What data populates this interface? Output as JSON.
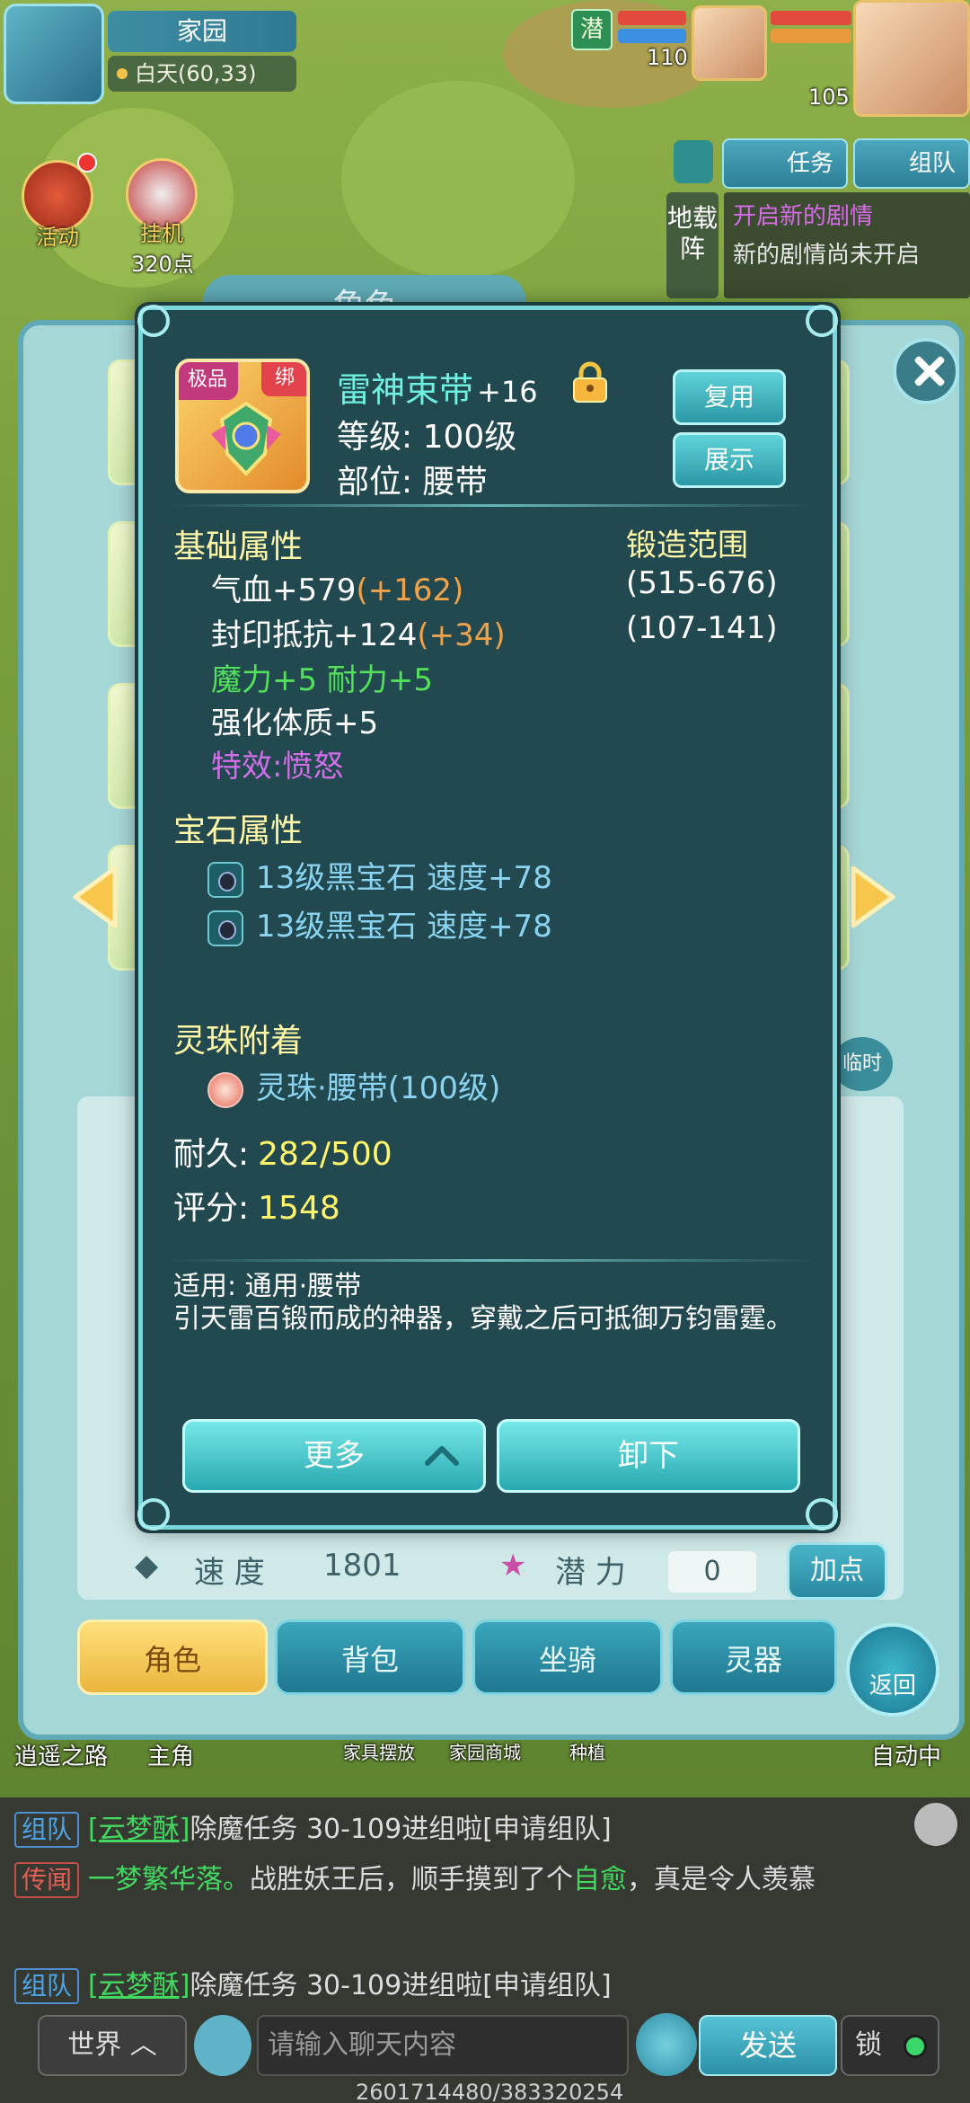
{
  "hud": {
    "home_title": "家园",
    "home_subtitle": "白天(60,33)",
    "activity_label": "活动",
    "idle_label": "挂机",
    "idle_points": "320点",
    "team_level_a": "110",
    "team_level_b": "105",
    "badge_hidden": "潜",
    "task_tab": "任务",
    "team_tab": "组队",
    "vertical_tab": "地载阵",
    "quest_title": "开启新的剧情",
    "quest_desc": "新的剧情尚未开启"
  },
  "character_panel": {
    "title": "角色",
    "speed_label": "速  度",
    "speed_value": "1801",
    "potential_label": "潜  力",
    "potential_value": "0",
    "add_point_button": "加点",
    "temp_label": "临时",
    "tabs": [
      "角色",
      "背包",
      "坐骑",
      "灵器"
    ],
    "return_button": "返回",
    "bottom_left_a": "逍遥之路",
    "bottom_left_b": "主角",
    "bottom_mid_a": "家具摆放",
    "bottom_mid_b": "家园商城",
    "bottom_mid_c": "种植",
    "bottom_right": "自动中"
  },
  "item": {
    "badge_top": "极品",
    "badge_bind": "绑",
    "name": "雷神束带",
    "enhance": "+16",
    "level": "等级: 100级",
    "part": "部位: 腰带",
    "reuse_button": "复用",
    "show_button": "展示",
    "basic_title": "基础属性",
    "forge_title": "锻造范围",
    "attrs": [
      {
        "base": "气血+579",
        "bonus": "(+162)",
        "range": "(515-676)"
      },
      {
        "base": "封印抵抗+124",
        "bonus": "(+34)",
        "range": "(107-141)"
      }
    ],
    "green_attrs": "魔力+5 耐力+5",
    "enhance_attr": "强化体质+5",
    "special_effect": "特效:愤怒",
    "gem_title": "宝石属性",
    "gems": [
      "13级黑宝石 速度+78",
      "13级黑宝石 速度+78"
    ],
    "orb_title": "灵珠附着",
    "orb": "灵珠·腰带(100级)",
    "durability_label": "耐久:",
    "durability_value": "282/500",
    "score_label": "评分:",
    "score_value": "1548",
    "applicable": "适用: 通用·腰带",
    "description": "引天雷百锻而成的神器，穿戴之后可抵御万钧雷霆。",
    "more_button": "更多",
    "unequip_button": "卸下"
  },
  "chat": {
    "lines": [
      {
        "channel": "组队",
        "name": "[云梦酥]",
        "text": "除魔任务 30-109进组啦",
        "link": "[申请组队]"
      },
      {
        "channel": "传闻",
        "pre": "一梦繁华落。",
        "text": "战胜妖王后，顺手摸到了个",
        "tag": "自愈",
        "post": "，真是令人羡慕"
      },
      {
        "channel": "组队",
        "name": "[云梦酥]",
        "text": "除魔任务 30-109进组啦",
        "link": "[申请组队]"
      }
    ],
    "world_button": "世界",
    "input_placeholder": "请输入聊天内容",
    "send_button": "发送",
    "lock_button": "锁",
    "footer_id": "2601714480/383320254"
  },
  "colors": {
    "modal_bg": "#22494f",
    "modal_border": "#79d6db",
    "item_name": "#6ff0e0",
    "section_title": "#fff7a6",
    "bonus": "#f0a24b",
    "green": "#53e05a",
    "purple": "#d26ee8"
  }
}
